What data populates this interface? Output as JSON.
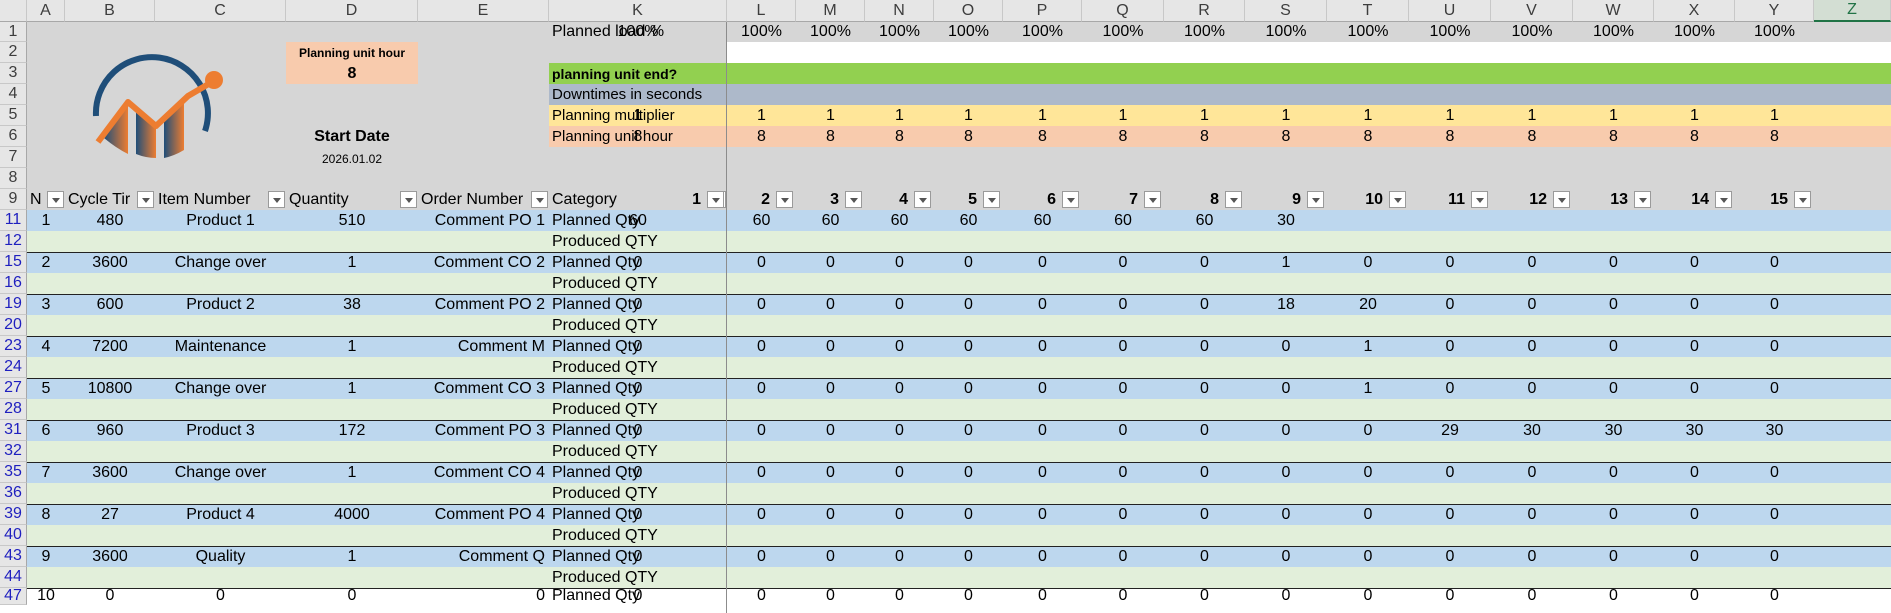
{
  "colors": {
    "header_bg": "#e6e6e6",
    "grey_area": "#d6d6d6",
    "planned_row": "#bdd7ee",
    "produced_row": "#e2efda",
    "green_bar": "#92d050",
    "slate_bar": "#adb9ca",
    "yellow_bar": "#ffe699",
    "orange_bar": "#f8cbad",
    "row_number_blue": "#1f1fbf",
    "logo_ring": "#1f4e79",
    "logo_orange": "#ed7d31"
  },
  "column_letters": [
    "A",
    "B",
    "C",
    "D",
    "E",
    "K",
    "L",
    "M",
    "N",
    "O",
    "P",
    "Q",
    "R",
    "S",
    "T",
    "U",
    "V",
    "W",
    "X",
    "Y",
    "Z"
  ],
  "selected_column": "Z",
  "row_numbers": [
    "1",
    "2",
    "3",
    "4",
    "5",
    "6",
    "7",
    "8",
    "9",
    "11",
    "12",
    "15",
    "16",
    "19",
    "20",
    "23",
    "24",
    "27",
    "28",
    "31",
    "32",
    "35",
    "36",
    "39",
    "40",
    "43",
    "44",
    "47"
  ],
  "logo": {
    "icon": "trend-chart-logo-icon"
  },
  "planning_unit_box": {
    "label": "Planning unit hour",
    "value": "8"
  },
  "start_date": {
    "label": "Start Date",
    "value": "2026.01.02"
  },
  "settings": {
    "planned_load": {
      "label": "Planned load %",
      "values": [
        "100%",
        "100%",
        "100%",
        "100%",
        "100%",
        "100%",
        "100%",
        "100%",
        "100%",
        "100%",
        "100%",
        "100%",
        "100%",
        "100%",
        "100%"
      ]
    },
    "planning_unit_end": {
      "label": "planning unit end?"
    },
    "downtimes": {
      "label": "Downtimes in seconds"
    },
    "planning_multiplier": {
      "label": "Planning multiplier",
      "values": [
        "1",
        "1",
        "1",
        "1",
        "1",
        "1",
        "1",
        "1",
        "1",
        "1",
        "1",
        "1",
        "1",
        "1",
        "1"
      ]
    },
    "planning_unit_hour": {
      "label": "Planning unit hour",
      "values": [
        "8",
        "8",
        "8",
        "8",
        "8",
        "8",
        "8",
        "8",
        "8",
        "8",
        "8",
        "8",
        "8",
        "8",
        "8"
      ]
    }
  },
  "table_headers": {
    "no": "N",
    "cycle_time": "Cycle Tir",
    "item_number": "Item Number",
    "quantity": "Quantity",
    "order_number": "Order Number",
    "category": "Category",
    "periods": [
      "1",
      "2",
      "3",
      "4",
      "5",
      "6",
      "7",
      "8",
      "9",
      "10",
      "11",
      "12",
      "13",
      "14",
      "15"
    ]
  },
  "orders": [
    {
      "no": "1",
      "cycle_time": "480",
      "item": "Product 1",
      "quantity": "510",
      "order": "Comment PO 1",
      "planned_label": "Planned Qty",
      "produced_label": "Produced QTY",
      "planned": [
        "60",
        "60",
        "60",
        "60",
        "60",
        "60",
        "60",
        "60",
        "30",
        "",
        "",
        "",
        "",
        "",
        ""
      ]
    },
    {
      "no": "2",
      "cycle_time": "3600",
      "item": "Change over",
      "quantity": "1",
      "order": "Comment CO 2",
      "planned_label": "Planned Qty",
      "produced_label": "Produced QTY",
      "planned": [
        "0",
        "0",
        "0",
        "0",
        "0",
        "0",
        "0",
        "0",
        "1",
        "0",
        "0",
        "0",
        "0",
        "0",
        "0"
      ]
    },
    {
      "no": "3",
      "cycle_time": "600",
      "item": "Product 2",
      "quantity": "38",
      "order": "Comment PO 2",
      "planned_label": "Planned Qty",
      "produced_label": "Produced QTY",
      "planned": [
        "0",
        "0",
        "0",
        "0",
        "0",
        "0",
        "0",
        "0",
        "18",
        "20",
        "0",
        "0",
        "0",
        "0",
        "0"
      ]
    },
    {
      "no": "4",
      "cycle_time": "7200",
      "item": "Maintenance",
      "quantity": "1",
      "order": "Comment M",
      "planned_label": "Planned Qty",
      "produced_label": "Produced QTY",
      "planned": [
        "0",
        "0",
        "0",
        "0",
        "0",
        "0",
        "0",
        "0",
        "0",
        "1",
        "0",
        "0",
        "0",
        "0",
        "0"
      ]
    },
    {
      "no": "5",
      "cycle_time": "10800",
      "item": "Change over",
      "quantity": "1",
      "order": "Comment CO 3",
      "planned_label": "Planned Qty",
      "produced_label": "Produced QTY",
      "planned": [
        "0",
        "0",
        "0",
        "0",
        "0",
        "0",
        "0",
        "0",
        "0",
        "1",
        "0",
        "0",
        "0",
        "0",
        "0"
      ]
    },
    {
      "no": "6",
      "cycle_time": "960",
      "item": "Product 3",
      "quantity": "172",
      "order": "Comment PO 3",
      "planned_label": "Planned Qty",
      "produced_label": "Produced QTY",
      "planned": [
        "0",
        "0",
        "0",
        "0",
        "0",
        "0",
        "0",
        "0",
        "0",
        "0",
        "29",
        "30",
        "30",
        "30",
        "30"
      ]
    },
    {
      "no": "7",
      "cycle_time": "3600",
      "item": "Change over",
      "quantity": "1",
      "order": "Comment CO 4",
      "planned_label": "Planned Qty",
      "produced_label": "Produced QTY",
      "planned": [
        "0",
        "0",
        "0",
        "0",
        "0",
        "0",
        "0",
        "0",
        "0",
        "0",
        "0",
        "0",
        "0",
        "0",
        "0"
      ]
    },
    {
      "no": "8",
      "cycle_time": "27",
      "item": "Product 4",
      "quantity": "4000",
      "order": "Comment PO 4",
      "planned_label": "Planned Qty",
      "produced_label": "Produced QTY",
      "planned": [
        "0",
        "0",
        "0",
        "0",
        "0",
        "0",
        "0",
        "0",
        "0",
        "0",
        "0",
        "0",
        "0",
        "0",
        "0"
      ]
    },
    {
      "no": "9",
      "cycle_time": "3600",
      "item": "Quality",
      "quantity": "1",
      "order": "Comment Q",
      "planned_label": "Planned Qty",
      "produced_label": "Produced QTY",
      "planned": [
        "0",
        "0",
        "0",
        "0",
        "0",
        "0",
        "0",
        "0",
        "0",
        "0",
        "0",
        "0",
        "0",
        "0",
        "0"
      ]
    },
    {
      "no": "10",
      "cycle_time": "0",
      "item": "0",
      "quantity": "0",
      "order": "0",
      "planned_label": "Planned Qty",
      "produced_label": "",
      "planned": [
        "0",
        "0",
        "0",
        "0",
        "0",
        "0",
        "0",
        "0",
        "0",
        "0",
        "0",
        "0",
        "0",
        "0",
        "0"
      ]
    }
  ]
}
